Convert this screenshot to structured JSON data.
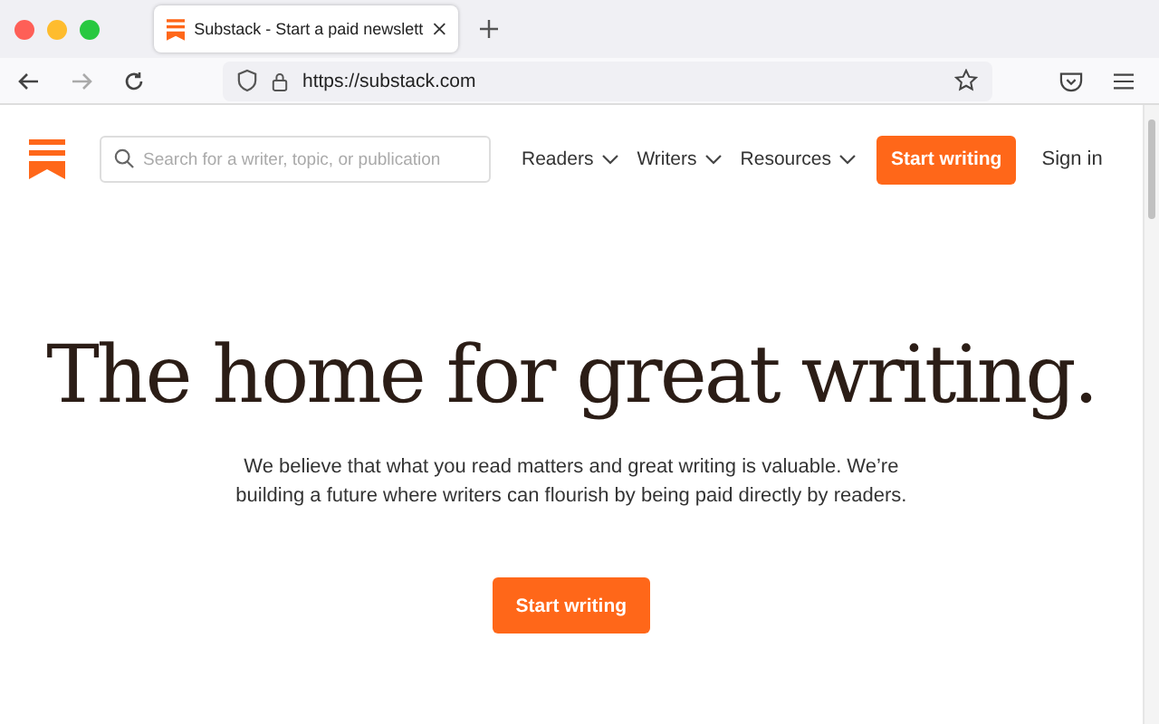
{
  "browser": {
    "tabs": [
      {
        "title": "Substack - Start a paid newslett",
        "selected": true
      }
    ],
    "url": "https://substack.com"
  },
  "nav": {
    "search": {
      "placeholder": "Search for a writer, topic, or publication"
    },
    "menus": [
      "Readers",
      "Writers",
      "Resources"
    ],
    "cta": "Start writing",
    "sign_in": "Sign in"
  },
  "hero": {
    "headline": "The home for great writing.",
    "body": "We believe that what you read matters and great writing is valuable. We’re building a future where writers can flourish by being paid directly by readers.",
    "button": "Start writing"
  }
}
